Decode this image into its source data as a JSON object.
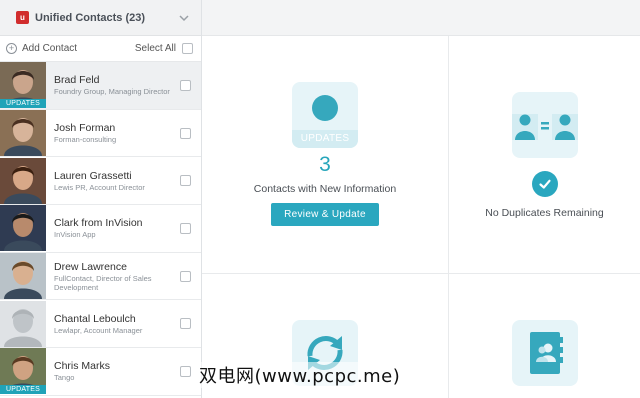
{
  "sidebar": {
    "title": "Unified Contacts (23)",
    "add_contact": "Add Contact",
    "select_all": "Select All",
    "contacts": [
      {
        "name": "Brad Feld",
        "subtitle": "Foundry Group, Managing Director",
        "updates": "UPDATES",
        "skin": "#caa58c",
        "hair": "#3a2a22",
        "bg": "#7a6a55"
      },
      {
        "name": "Josh Forman",
        "subtitle": "Forman-consulting",
        "updates": "",
        "skin": "#d7b49a",
        "hair": "#4a3020",
        "bg": "#8a7055"
      },
      {
        "name": "Lauren Grassetti",
        "subtitle": "Lewis PR, Account Director",
        "updates": "",
        "skin": "#d8a888",
        "hair": "#3b2010",
        "bg": "#6a4a3a"
      },
      {
        "name": "Clark from InVision",
        "subtitle": "InVision App",
        "updates": "",
        "skin": "#b88a6c",
        "hair": "#1a1a1a",
        "bg": "#2f3b52"
      },
      {
        "name": "Drew Lawrence",
        "subtitle": "FullContact, Director of Sales Development",
        "updates": "",
        "skin": "#d9b090",
        "hair": "#6a4a2a",
        "bg": "#b9c2c8"
      },
      {
        "name": "Chantal Leboulch",
        "subtitle": "Lewlapr, Account Manager",
        "updates": "",
        "skin": "#bfc4c8",
        "hair": "#aeb3b7",
        "bg": "#dfe2e5"
      },
      {
        "name": "Chris Marks",
        "subtitle": "Tango",
        "updates": "UPDATES",
        "skin": "#cfa282",
        "hair": "#5a3a22",
        "bg": "#6f7a55"
      }
    ]
  },
  "main": {
    "updates_tile_label": "UPDATES",
    "updates_count": "3",
    "updates_caption": "Contacts with New Information",
    "review_button": "Review & Update",
    "duplicates_caption": "No Duplicates Remaining"
  },
  "watermark": "双电网(www.pcpc.me)",
  "colors": {
    "accent": "#2aa7bf",
    "brand_red": "#d12d2d",
    "tile_bg": "#e6f4f8"
  }
}
